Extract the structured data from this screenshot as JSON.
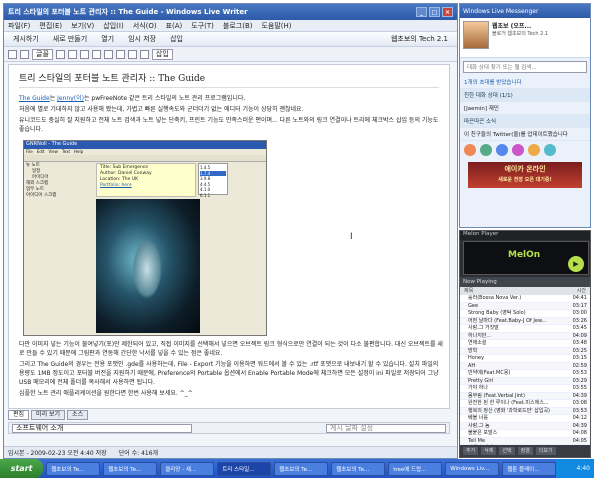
{
  "writer": {
    "title": "트리 스타일의 포터블 노트 관리자 :: The Guide - Windows Live Writer",
    "menu": [
      "파일(F)",
      "편집(E)",
      "보기(V)",
      "삽입(I)",
      "서식(O)",
      "표(A)",
      "도구(T)",
      "블로그(B)",
      "도움말(H)"
    ],
    "toolbar1": [
      "게시하기",
      "새로 만들기",
      "열기",
      "임시 저장",
      "삽입"
    ],
    "blog_name": "웹초보의 Tech 2.1",
    "toolbar2_items": [
      "글꼴",
      "삽입"
    ],
    "doc": {
      "title": "트리 스타일의 포터블 노트 관리자 :: The Guide",
      "p1_link": "The Guide",
      "p1_link2": "Jenny(이)",
      "p1": "는 pwFreeNote 같은 트리 스타일의 노트 관리 프로그램입니다.",
      "p2": "처음에 별로 기대하지 않고 사용해 봤는데, 가볍고 빠른 실행속도와 군더더기 없는 에디터 기능이 상당히 괜찮네요.",
      "p3": "유니코드도 충실히 잘 지원하고 전체 노트 검색과 노트 넣는 단축키, 프린트 기능도 만족스러운 편이며... 다른 노트와의 링크 연결이나 트리에 체크박스 삽입 등의 기능도 좋습니다.",
      "p4": "다만 이미지 넣는 기능이 불여넣기(포)만 제한되어 있고, 직접 이미지를 선택해서 넣으면 오브젝트 링크 형식으로만 연결이 되는 것이 다소 불편합니다. 대신 오브젝트를 새로 만들 수 있기 때문에 그림판과 연동해 간단한 낙서를 넣을 수 있는 점은 좋네요.",
      "p5": "그리고 The Guide의 경우는 전용 포맷인 .gde를 사용하는데, File - Export 기능을 이용하면 워드에서 볼 수 있는 .rtf 포맷으로 내보내기 할 수 있습니다. 설치 파일의 용량도 1MB 정도이고 포터블 버전을 지원하기 때문에, Preference의 Portable 옵션에서 Enable Portable Mode에 체크하면 모든 설정이 ini 파일로 저장되어 그냥 USB 메모리에 전체 폴더를 복사해서 사용하면 됩니다.",
      "p6": "심플한 노트 관리 애플리케이션을 원한다면 한번 사용해 보세요. ^_^"
    },
    "screenshot": {
      "title": "GNRNoll - The Guide",
      "menu": [
        "File",
        "Edit",
        "View",
        "Text",
        "Help"
      ],
      "tree": [
        "뉴 노트",
        "일정",
        "아이디어",
        "해외 스크랩",
        "업무 노트",
        "아이디어 스크랩"
      ],
      "note_lines": [
        "Title: Sub Emergence",
        "Author: Daniel Conway",
        "Location: The UK",
        "Portfolio: here"
      ],
      "list": [
        "1.4.5",
        "1.7.4",
        "3.9.8",
        "4.4.5",
        "4.1.0",
        "6.1.1"
      ]
    },
    "tabs": [
      "편집",
      "미리 보기",
      "소스"
    ],
    "category_label": "소프트웨어 소개",
    "tags_placeholder": "게시 날짜 설정",
    "status": {
      "date": "임시본 - 2009-02-23 오전 4:40 저장",
      "words": "단어 수: 416개"
    }
  },
  "messenger": {
    "title": "Windows Live Messenger",
    "profile_name": "웹초보 (오프...",
    "profile_msg": "블로거 웹초보의 Tech 2.1",
    "search_placeholder": "대화 상대 찾기 또는 웹 검색...",
    "notice": "1개의 초대를 받았습니다",
    "group1": "친한 대화 상대 (1/1)",
    "contact1": "[Jaemin] 재민",
    "friends_header": "따끈따끈 소식",
    "friends_news": "이 친구들의 Twitter(을)를 업데이트했습니다",
    "ad_line1": "에이카 온라인",
    "ad_line2": "새로운 전장 오픈 대기중!"
  },
  "melon": {
    "title": "Melon Player",
    "logo": "MelOn",
    "now_playing": "Now Playing",
    "cols": {
      "title": "제목",
      "time": "시간"
    },
    "playlist": [
      [
        "흘러(Bossa Nova Ver.)",
        "04:41"
      ],
      [
        "Gee",
        "03:17"
      ],
      [
        "Strong Baby (영탁 Solo)",
        "03:00"
      ],
      [
        "어떤 날마다 (Feat.Baby-J Of Jew...",
        "03:26"
      ],
      [
        "사랑,그 거짓말",
        "03:45"
      ],
      [
        "하나지만...",
        "04:09"
      ],
      [
        "연애소설",
        "03:48"
      ],
      [
        "방학",
        "03:25"
      ],
      [
        "Honey",
        "03:15"
      ],
      [
        "AH",
        "02:59"
      ],
      [
        "만약에(Feat.MC몽)",
        "03:53"
      ],
      [
        "Pretty Girl",
        "03:29"
      ],
      [
        "가야 하나",
        "03:55"
      ],
      [
        "몸부림 (Feat.Verbal Jint)",
        "04:39"
      ],
      [
        "완전한 된 한 루이나 (Feat.미스에스...",
        "03:08"
      ],
      [
        "행복의 정신 (영화 '과학로드만' 삽입곡)",
        "03:53"
      ],
      [
        "베블 너를",
        "04:12"
      ],
      [
        "사랑,그 놈",
        "04:39"
      ],
      [
        "불붙은 포말스",
        "04:08"
      ],
      [
        "Tell Me",
        "04:05"
      ],
      [
        "잘해야 되지",
        "03:17"
      ]
    ],
    "btns": [
      "추가",
      "삭제",
      "선택",
      "정렬",
      "더보기"
    ]
  },
  "taskbar": {
    "start": "start",
    "tasks": [
      "웹초보의 Te...",
      "웹초보의 Te...",
      "클리앙 - 새...",
      "트리 스타일...",
      "웹초보의 Te...",
      "웹초보의 Te...",
      "tree에 드랍...",
      "Windows Liv...",
      "웹툰 플레이..."
    ],
    "clock": "4:40"
  },
  "colors": {
    "accent": "#2d5aa8",
    "melon_green": "#b6e04a",
    "taskbar": "#2152c3"
  }
}
